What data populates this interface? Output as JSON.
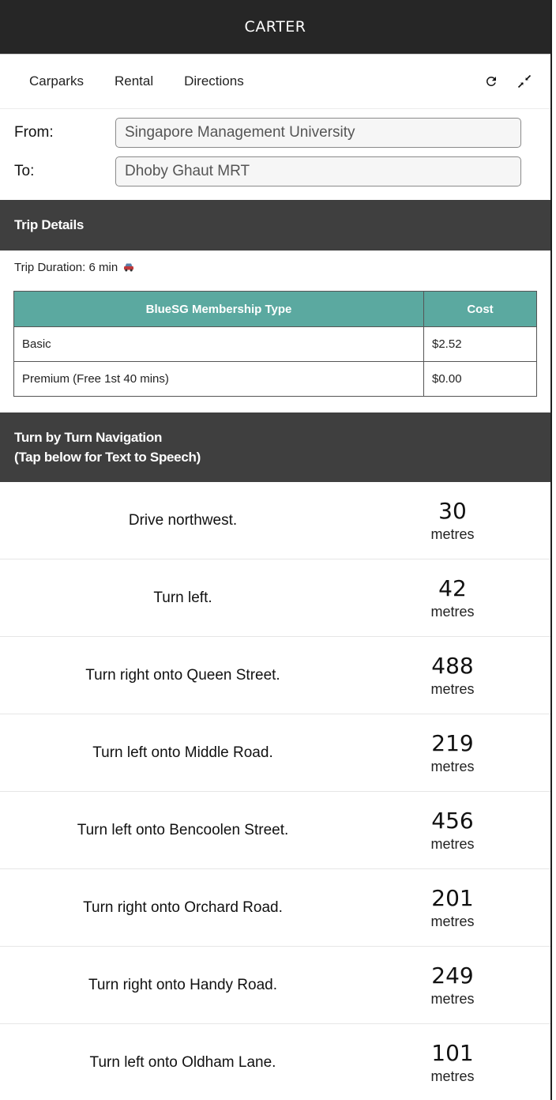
{
  "app": {
    "title": "CARTER"
  },
  "tabs": [
    {
      "label": "Carparks"
    },
    {
      "label": "Rental"
    },
    {
      "label": "Directions"
    }
  ],
  "toolbar_icons": [
    "refresh-icon",
    "collapse-icon"
  ],
  "route": {
    "from_label": "From:",
    "from_value": "Singapore Management University",
    "to_label": "To:",
    "to_value": "Dhoby Ghaut MRT"
  },
  "trip": {
    "header": "Trip Details",
    "duration": "Trip Duration: 6 min",
    "duration_icon": "car-icon"
  },
  "cost_table": {
    "headers": [
      "BlueSG Membership Type",
      "Cost"
    ],
    "rows": [
      [
        "Basic",
        "$2.52"
      ],
      [
        "Premium (Free 1st 40 mins)",
        "$0.00"
      ]
    ]
  },
  "navigation": {
    "header_line1": "Turn by Turn Navigation",
    "header_line2": "(Tap below for Text to Speech)",
    "steps": [
      {
        "text": "Drive northwest.",
        "distance": "30",
        "unit": "metres"
      },
      {
        "text": "Turn left.",
        "distance": "42",
        "unit": "metres"
      },
      {
        "text": "Turn right onto Queen Street.",
        "distance": "488",
        "unit": "metres"
      },
      {
        "text": "Turn left onto Middle Road.",
        "distance": "219",
        "unit": "metres"
      },
      {
        "text": "Turn left onto Bencoolen Street.",
        "distance": "456",
        "unit": "metres"
      },
      {
        "text": "Turn right onto Orchard Road.",
        "distance": "201",
        "unit": "metres"
      },
      {
        "text": "Turn right onto Handy Road.",
        "distance": "249",
        "unit": "metres"
      },
      {
        "text": "Turn left onto Oldham Lane.",
        "distance": "101",
        "unit": "metres"
      }
    ]
  },
  "colors": {
    "appbar": "#262626",
    "section_header": "#3f3f3f",
    "table_header": "#5ba9a0"
  }
}
